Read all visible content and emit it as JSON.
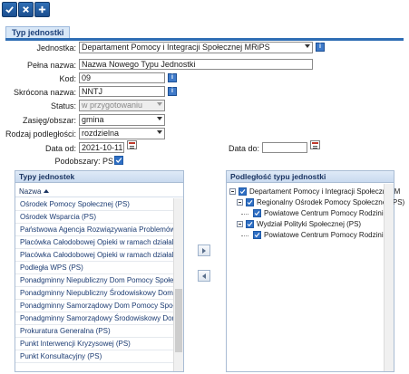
{
  "form": {
    "section_title": "Typ jednostki",
    "fields": {
      "jednostka": {
        "label": "Jednostka:",
        "value": "Departament Pomocy i Integracji Społecznej MRiPS"
      },
      "pelna_nazwa": {
        "label": "Pełna nazwa:",
        "value": "Nazwa Nowego Typu Jednostki"
      },
      "kod": {
        "label": "Kod:",
        "value": "09"
      },
      "skrocona_nazwa": {
        "label": "Skrócona nazwa:",
        "value": "NNTJ"
      },
      "status": {
        "label": "Status:",
        "value": "w przygotowaniu"
      },
      "zasieg": {
        "label": "Zasięg/obszar:",
        "value": "gmina"
      },
      "rodzaj_podleglosci": {
        "label": "Rodzaj podległości:",
        "value": "rozdzielna"
      },
      "data_od": {
        "label": "Data od:",
        "value": "2021-10-11"
      },
      "data_do": {
        "label": "Data do:",
        "value": ""
      },
      "podobszary": {
        "label": "Podobszary: PS",
        "checked": true
      }
    }
  },
  "left_panel": {
    "title": "Typy jednostek",
    "column": "Nazwa",
    "rows": [
      "Ośrodek Pomocy Społecznej (PS)",
      "Ośrodek Wsparcia (PS)",
      "Państwowa Agencja Rozwiązywania Problemów Al",
      "Placówka Całodobowej Opieki w ramach działalnośc",
      "Placówka Całodobowej Opieki w ramach działalnośc",
      "Podległa WPS (PS)",
      "Ponadgminny Niepubliczny Dom Pomocy Społecznej (",
      "Ponadgminny Niepubliczny Środowiskowy Dom Sam",
      "Ponadgminny Samorządowy Dom Pomocy Społeczne",
      "Ponadgminny Samorządowy Środowiskowy Dom Sam",
      "Prokuratura Generalna (PS)",
      "Punkt Interwencji Kryzysowej (PS)",
      "Punkt Konsultacyjny (PS)"
    ]
  },
  "right_panel": {
    "title": "Podległość typu jednostki",
    "tree": [
      {
        "label": "Departament Pomocy i Integracji Społecznej M",
        "level": 0
      },
      {
        "label": "Regionalny Ośrodek Pomocy Społecznej (PS)",
        "level": 1
      },
      {
        "label": "Powiatowe Centrum Pomocy Rodzinie (",
        "level": 2
      },
      {
        "label": "Wydział Polityki Społecznej (PS)",
        "level": 1
      },
      {
        "label": "Powiatowe Centrum Pomocy Rodzinie (",
        "level": 2
      }
    ]
  },
  "icons": {
    "save": "check-icon",
    "cancel": "x-icon",
    "add": "plus-icon",
    "info": "info-icon",
    "calendar": "calendar-icon"
  },
  "colors": {
    "accent": "#2e6db4",
    "toolbar_button": "#1b4e8f",
    "list_text": "#1c3c73"
  }
}
